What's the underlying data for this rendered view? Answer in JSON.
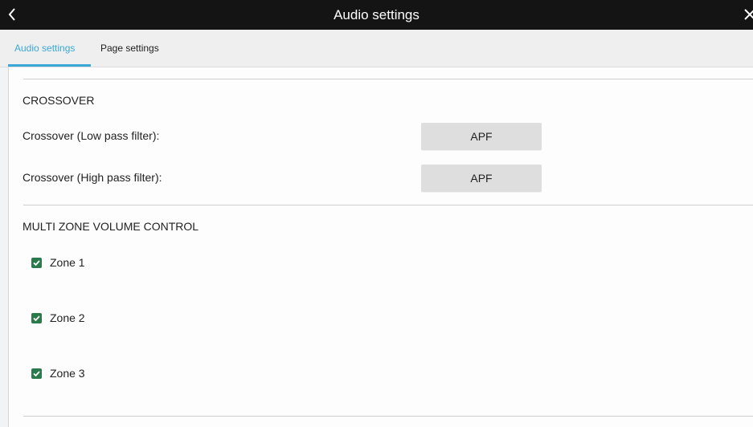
{
  "window": {
    "title": "Audio settings",
    "back_icon": "chevron-left-icon",
    "close_icon": "close-icon"
  },
  "tabs": [
    {
      "label": "Audio settings",
      "active": true
    },
    {
      "label": "Page settings",
      "active": false
    }
  ],
  "crossover": {
    "title": "CROSSOVER",
    "rows": [
      {
        "label": "Crossover (Low pass filter):",
        "value": "APF"
      },
      {
        "label": "Crossover (High pass filter):",
        "value": "APF"
      }
    ]
  },
  "multizone": {
    "title": "MULTI ZONE VOLUME CONTROL",
    "zones": [
      {
        "label": "Zone 1",
        "checked": true
      },
      {
        "label": "Zone 2",
        "checked": true
      },
      {
        "label": "Zone 3",
        "checked": true
      }
    ]
  },
  "colors": {
    "accent": "#3aa7d6",
    "checkbox": "#2b7a4b",
    "titlebar": "#141414"
  }
}
